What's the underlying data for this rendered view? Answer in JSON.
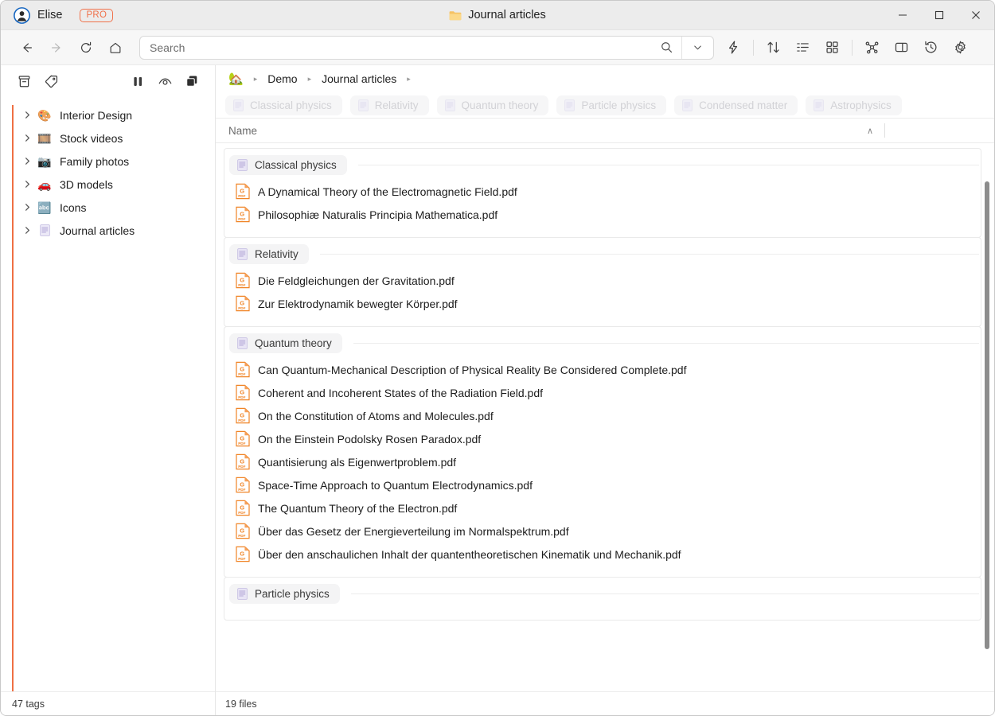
{
  "titlebar": {
    "user_name": "Elise",
    "pro_badge": "PRO",
    "window_title": "Journal articles",
    "minimize": "—",
    "maximize": "□",
    "close": "✕"
  },
  "toolbar": {
    "back": "back-arrow",
    "forward": "forward-arrow",
    "reload": "reload",
    "home": "home",
    "search_placeholder": "Search",
    "search_value": "",
    "icons": [
      "search",
      "chevron-down",
      "flash",
      "sort",
      "list-view",
      "grid-view",
      "graph",
      "panel",
      "history",
      "settings"
    ]
  },
  "sidebar": {
    "tools": [
      "archive",
      "tag",
      "columns",
      "eye",
      "layers"
    ],
    "items": [
      {
        "emoji": "🎨",
        "label": "Interior Design"
      },
      {
        "emoji": "🎞️",
        "label": "Stock videos"
      },
      {
        "emoji": "📷",
        "label": "Family photos"
      },
      {
        "emoji": "🚗",
        "label": "3D models"
      },
      {
        "emoji": "🔤",
        "label": "Icons"
      },
      {
        "emoji": "📄",
        "label": "Journal articles"
      }
    ],
    "tag_count": "47 tags"
  },
  "main": {
    "breadcrumb": {
      "home_icon": "🏡",
      "items": [
        "Demo",
        "Journal articles"
      ],
      "separator": "▸"
    },
    "ghost_chips": [
      "Classical physics",
      "Relativity",
      "Quantum theory",
      "Particle physics",
      "Condensed matter",
      "Astrophysics"
    ],
    "column_header": {
      "name": "Name",
      "sort_caret": "∧"
    },
    "groups": [
      {
        "label": "Classical physics",
        "files": [
          "A Dynamical Theory of the Electromagnetic Field.pdf",
          "Philosophiæ Naturalis Principia Mathematica.pdf"
        ]
      },
      {
        "label": "Relativity",
        "files": [
          "Die Feldgleichungen der Gravitation.pdf",
          "Zur Elektrodynamik bewegter Körper.pdf"
        ]
      },
      {
        "label": "Quantum theory",
        "files": [
          "Can Quantum-Mechanical Description of Physical Reality Be Considered Complete.pdf",
          "Coherent and Incoherent States of the Radiation Field.pdf",
          "On the Constitution of Atoms and Molecules.pdf",
          "On the Einstein Podolsky Rosen Paradox.pdf",
          "Quantisierung als Eigenwertproblem.pdf",
          "Space-Time Approach to Quantum Electrodynamics.pdf",
          "The Quantum Theory of the Electron.pdf",
          "Über das Gesetz der Energieverteilung im Normalspektrum.pdf",
          "Über den anschaulichen Inhalt der quantentheoretischen Kinematik und Mechanik.pdf"
        ]
      },
      {
        "label": "Particle physics",
        "files": []
      }
    ],
    "status": "19 files"
  },
  "colors": {
    "accent_orange": "#ef7043",
    "pdf_orange": "#f08426",
    "titlebar_bg": "#ececec",
    "toolbar_bg": "#f7f7f7"
  }
}
